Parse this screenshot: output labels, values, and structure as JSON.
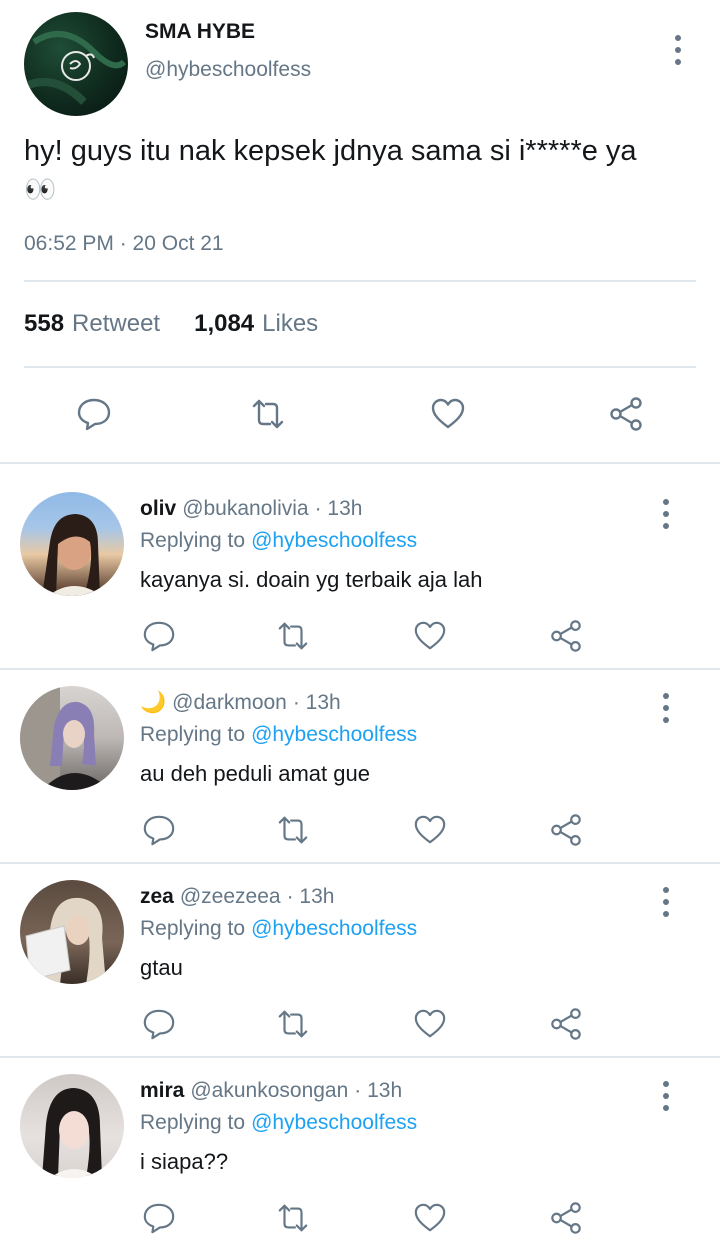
{
  "tweet": {
    "display_name": "SMA HYBE",
    "handle": "@hybeschoolfess",
    "text_line1": "hy! guys itu nak kepsek jdnya sama si i*****e ya",
    "text_emoji": "👀",
    "timestamp": "06:52 PM · 20 Oct 21",
    "retweet_count": "558",
    "retweet_label": "Retweet",
    "likes_count": "1,084",
    "likes_label": "Likes"
  },
  "replies": [
    {
      "name": "oliv",
      "handle": "@bukanolivia",
      "time": "· 13h",
      "replying_prefix": "Replying to",
      "replying_handle": "@hybeschoolfess",
      "text": "kayanya si. doain yg terbaik aja lah"
    },
    {
      "name": "🌙",
      "handle": "@darkmoon",
      "time": "· 13h",
      "replying_prefix": "Replying to",
      "replying_handle": "@hybeschoolfess",
      "text": "au deh peduli amat gue"
    },
    {
      "name": "zea",
      "handle": "@zeezeea",
      "time": "· 13h",
      "replying_prefix": "Replying to",
      "replying_handle": "@hybeschoolfess",
      "text": "gtau"
    },
    {
      "name": "mira",
      "handle": "@akunkosongan",
      "time": "· 13h",
      "replying_prefix": "Replying to",
      "replying_handle": "@hybeschoolfess",
      "text": "i siapa??"
    }
  ],
  "icons": {
    "reply": "speech-bubble-icon",
    "retweet": "retweet-arrows-icon",
    "like": "heart-icon",
    "share": "share-nodes-icon",
    "more": "vertical-dots-icon"
  },
  "colors": {
    "link": "#1da1f2",
    "muted": "#657786",
    "text": "#14171a",
    "divider": "#e1e8ed"
  }
}
